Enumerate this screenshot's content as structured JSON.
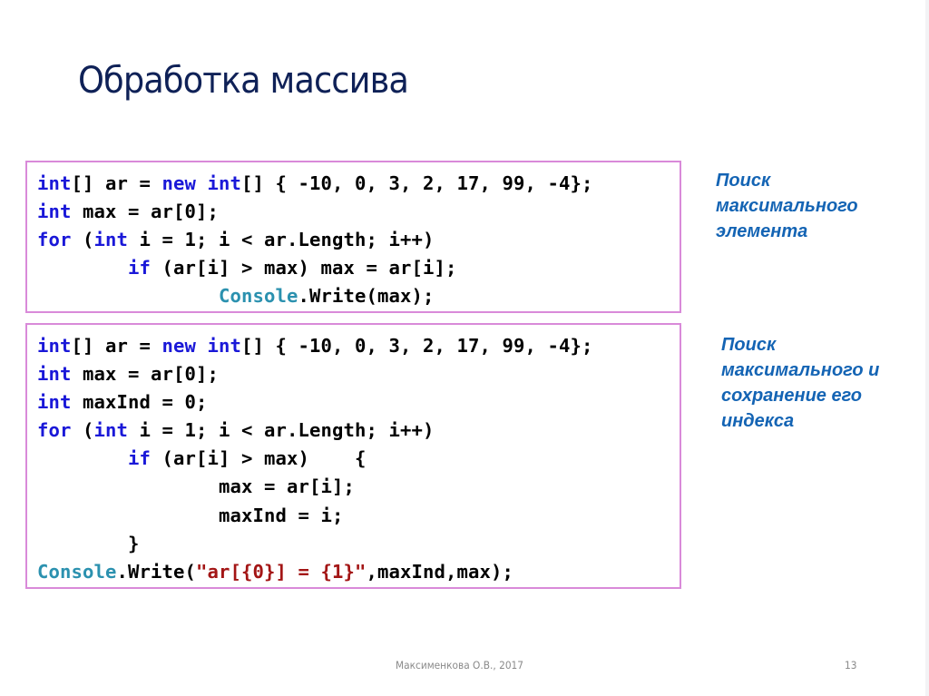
{
  "slide": {
    "title": "Обработка массива",
    "page_number": "13",
    "footer": "Максименкова О.В., 2017"
  },
  "colors": {
    "title": "#0f2157",
    "keyword": "#1a18d8",
    "class": "#2b91af",
    "string": "#a31515",
    "note": "#1464b4",
    "box_border": "#d98ad9",
    "footer": "#8a8a8a"
  },
  "examples": [
    {
      "note_lines": [
        "Поиск",
        "максимального",
        "элемента"
      ],
      "code_lines": [
        [
          {
            "t": "kw",
            "v": "int"
          },
          {
            "t": "",
            "v": "[] ar = "
          },
          {
            "t": "kw",
            "v": "new"
          },
          {
            "t": "",
            "v": " "
          },
          {
            "t": "kw",
            "v": "int"
          },
          {
            "t": "",
            "v": "[] { -10, 0, 3, 2, 17, 99, -4};"
          }
        ],
        [
          {
            "t": "kw",
            "v": "int"
          },
          {
            "t": "",
            "v": " max = ar[0];"
          }
        ],
        [
          {
            "t": "kw",
            "v": "for"
          },
          {
            "t": "",
            "v": " ("
          },
          {
            "t": "kw",
            "v": "int"
          },
          {
            "t": "",
            "v": " i = 1; i < ar.Length; i++)"
          }
        ],
        [
          {
            "t": "",
            "v": "        "
          },
          {
            "t": "kw",
            "v": "if"
          },
          {
            "t": "",
            "v": " (ar[i] > max) max = ar[i];"
          }
        ],
        [
          {
            "t": "",
            "v": "                "
          },
          {
            "t": "cls",
            "v": "Console"
          },
          {
            "t": "",
            "v": ".Write(max);"
          }
        ]
      ]
    },
    {
      "note_lines": [
        "Поиск",
        "максимального и",
        "сохранение его",
        "индекса"
      ],
      "code_lines": [
        [
          {
            "t": "kw",
            "v": "int"
          },
          {
            "t": "",
            "v": "[] ar = "
          },
          {
            "t": "kw",
            "v": "new"
          },
          {
            "t": "",
            "v": " "
          },
          {
            "t": "kw",
            "v": "int"
          },
          {
            "t": "",
            "v": "[] { -10, 0, 3, 2, 17, 99, -4};"
          }
        ],
        [
          {
            "t": "kw",
            "v": "int"
          },
          {
            "t": "",
            "v": " max = ar[0];"
          }
        ],
        [
          {
            "t": "kw",
            "v": "int"
          },
          {
            "t": "",
            "v": " maxInd = 0;"
          }
        ],
        [
          {
            "t": "kw",
            "v": "for"
          },
          {
            "t": "",
            "v": " ("
          },
          {
            "t": "kw",
            "v": "int"
          },
          {
            "t": "",
            "v": " i = 1; i < ar.Length; i++)"
          }
        ],
        [
          {
            "t": "",
            "v": "        "
          },
          {
            "t": "kw",
            "v": "if"
          },
          {
            "t": "",
            "v": " (ar[i] > max)    {"
          }
        ],
        [
          {
            "t": "",
            "v": "                max = ar[i];"
          }
        ],
        [
          {
            "t": "",
            "v": "                maxInd = i;"
          }
        ],
        [
          {
            "t": "",
            "v": "        }"
          }
        ],
        [
          {
            "t": "cls",
            "v": "Console"
          },
          {
            "t": "",
            "v": ".Write("
          },
          {
            "t": "str",
            "v": "\"ar[{0}] = {1}\""
          },
          {
            "t": "",
            "v": ",maxInd,max);"
          }
        ]
      ]
    }
  ]
}
